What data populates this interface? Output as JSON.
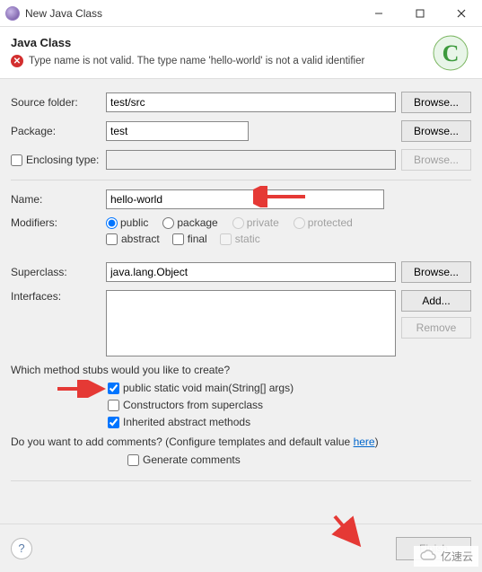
{
  "titlebar": {
    "title": "New Java Class"
  },
  "header": {
    "title": "Java Class",
    "error": "Type name is not valid. The type name 'hello-world' is not a valid identifier"
  },
  "form": {
    "source_folder": {
      "label": "Source folder:",
      "value": "test/src",
      "browse": "Browse..."
    },
    "package": {
      "label": "Package:",
      "value": "test",
      "browse": "Browse..."
    },
    "enclosing": {
      "label": "Enclosing type:",
      "value": "",
      "browse": "Browse..."
    },
    "name": {
      "label": "Name:",
      "value": "hello-world"
    },
    "modifiers": {
      "label": "Modifiers:",
      "public": "public",
      "package": "package",
      "private": "private",
      "protected": "protected",
      "abstract": "abstract",
      "final": "final",
      "static": "static"
    },
    "superclass": {
      "label": "Superclass:",
      "value": "java.lang.Object",
      "browse": "Browse..."
    },
    "interfaces": {
      "label": "Interfaces:",
      "add": "Add...",
      "remove": "Remove"
    }
  },
  "stubs": {
    "question": "Which method stubs would you like to create?",
    "main": "public static void main(String[] args)",
    "constructors": "Constructors from superclass",
    "inherited": "Inherited abstract methods"
  },
  "comments": {
    "question_prefix": "Do you want to add comments? (Configure templates and default value ",
    "here": "here",
    "question_suffix": ")",
    "generate": "Generate comments"
  },
  "footer": {
    "finish": "Finish"
  },
  "watermark": "亿速云"
}
